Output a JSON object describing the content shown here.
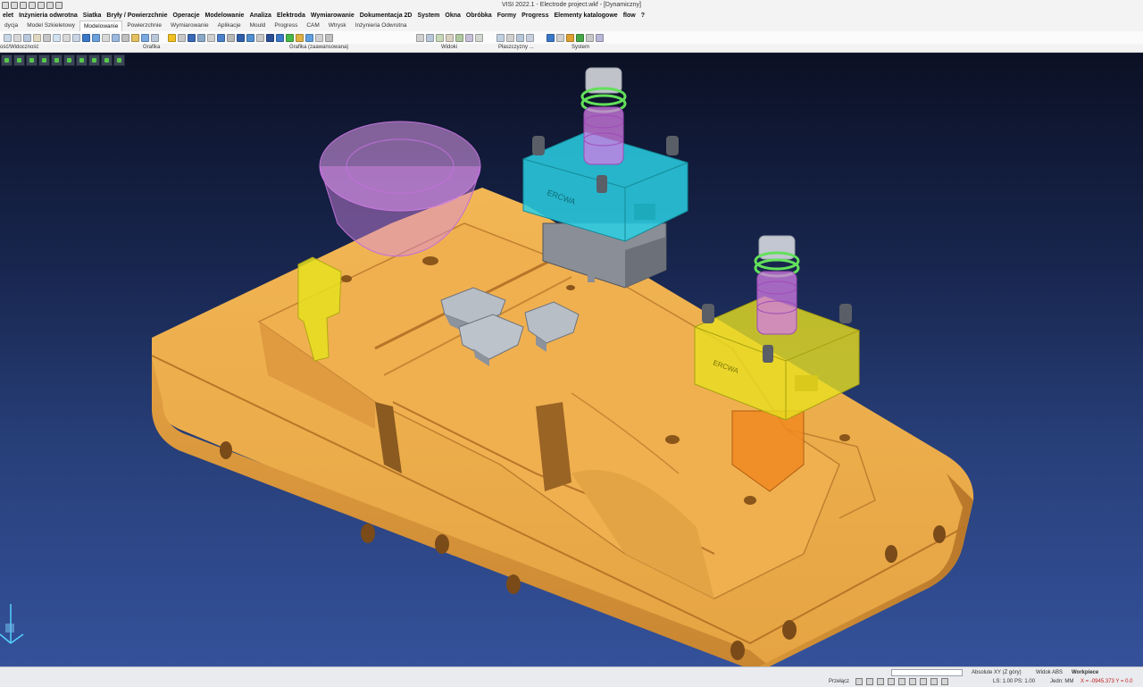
{
  "window": {
    "title": "VISI 2022.1 - Electrode project.wkf - [Dynamiczny]"
  },
  "menu": {
    "items": [
      "elet",
      "Inżynieria odwrotna",
      "Siatka",
      "Bryły / Powierzchnie",
      "Operacje",
      "Modelowanie",
      "Analiza",
      "Elektroda",
      "Wymiarowanie",
      "Dokumentacja 2D",
      "System",
      "Okna",
      "Obróbka",
      "Formy",
      "Progress",
      "Elementy katalogowe",
      "flow",
      "?"
    ]
  },
  "ribbon": {
    "tabs": [
      "dycja",
      "Model Szkieletowy",
      "Modelowanie",
      "Powierzchnie",
      "Wymiarowanie",
      "Aplikacje",
      "Mould",
      "Progress",
      "CAM",
      "Wtrysk",
      "Inżynieria Odwrotna"
    ],
    "active_tab": "Modelowanie",
    "groups": [
      "ość/Widoczność",
      "Grafika",
      "Grafika (zaawansowana)",
      "Widoki",
      "Płaszczyzny ...",
      "System"
    ]
  },
  "status": {
    "left_label": "Przełącz",
    "plane": "Absolute XY (Z góry)",
    "view": "Widok ABS",
    "workpiece": "Workpiece",
    "scale": "LS: 1.00 PS: 1.00",
    "units": "Jedn: MM",
    "coords": "X = -0945.373 Y = 0.0"
  },
  "colors": {
    "part": "#e8a848",
    "cyan_holder": "#2ad0e4",
    "yellow_holder": "#e8e020",
    "electrode_purple": "#d47ee6",
    "electrode_green": "#63e05a"
  },
  "logo": {
    "text": "ERCWA"
  }
}
